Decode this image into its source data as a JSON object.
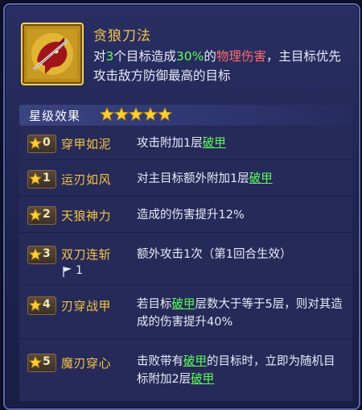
{
  "skill": {
    "name": "贪狼刀法",
    "desc": {
      "p1": "对",
      "num_targets": "3",
      "p2": "个目标造成",
      "percent": "30%",
      "p3": "的",
      "dmg_type": "物理伤害",
      "p4": "，主目标优先攻击敌方防御最高的目标"
    },
    "icon": "fox-warrior-icon"
  },
  "section": {
    "title": "星级效果",
    "stars": 5
  },
  "levels": [
    {
      "star": "0",
      "name": "穿甲如泥",
      "d1": "攻击附加1层",
      "link1": "破甲",
      "d2": "",
      "link2": "",
      "d3": ""
    },
    {
      "star": "1",
      "name": "运刃如风",
      "d1": "对主目标额外附加1层",
      "link1": "破甲",
      "d2": "",
      "link2": "",
      "d3": ""
    },
    {
      "star": "2",
      "name": "天狼神力",
      "d1": "造成的伤害提升12%",
      "link1": "",
      "d2": "",
      "link2": "",
      "d3": ""
    },
    {
      "star": "3",
      "name": "双刀连斩",
      "d1": "额外攻击1次（第1回合生效）",
      "link1": "",
      "d2": "",
      "link2": "",
      "d3": "",
      "flag_count": "1"
    },
    {
      "star": "4",
      "name": "刃穿战甲",
      "d1": "若目标",
      "link1": "破甲",
      "d2": "层数大于等于5层，则对其造成的伤害提升40%",
      "link2": "",
      "d3": ""
    },
    {
      "star": "5",
      "name": "魔刃穿心",
      "d1": "击败带有",
      "link1": "破甲",
      "d2": "的目标时，立即为随机目标附加2层",
      "link2": "破甲",
      "d3": ""
    }
  ],
  "colors": {
    "gold": "#f6c445",
    "green": "#5dff5d",
    "red": "#ff6a6a",
    "panel": "#1f2350"
  }
}
